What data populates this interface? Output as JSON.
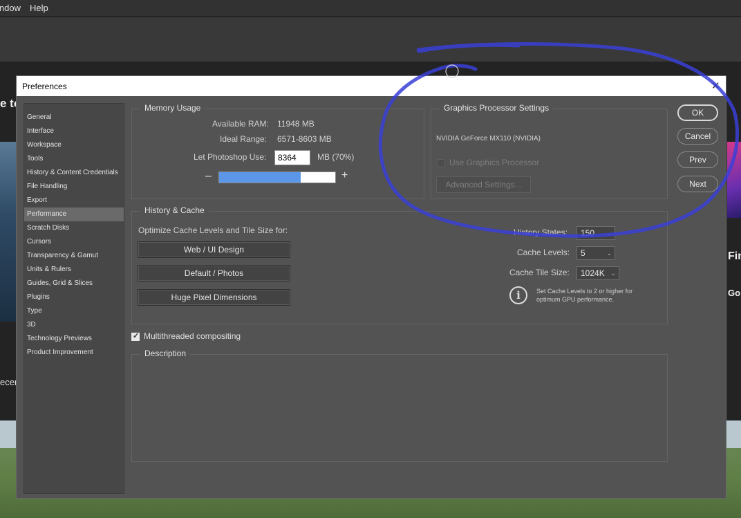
{
  "menubar": {
    "items": [
      "indow",
      "Help"
    ]
  },
  "background": {
    "left_heading": "e to",
    "left_text": "ecent",
    "right_text1": "Fin",
    "right_text2": "Go"
  },
  "dialog": {
    "title": "Preferences",
    "close_glyph": "✕"
  },
  "sidebar": {
    "items": [
      {
        "label": "General"
      },
      {
        "label": "Interface"
      },
      {
        "label": "Workspace"
      },
      {
        "label": "Tools"
      },
      {
        "label": "History & Content Credentials"
      },
      {
        "label": "File Handling"
      },
      {
        "label": "Export"
      },
      {
        "label": "Performance",
        "active": true
      },
      {
        "label": "Scratch Disks"
      },
      {
        "label": "Cursors"
      },
      {
        "label": "Transparency & Gamut"
      },
      {
        "label": "Units & Rulers"
      },
      {
        "label": "Guides, Grid & Slices"
      },
      {
        "label": "Plugins"
      },
      {
        "label": "Type"
      },
      {
        "label": "3D"
      },
      {
        "label": "Technology Previews"
      },
      {
        "label": "Product Improvement"
      }
    ]
  },
  "memory": {
    "legend": "Memory Usage",
    "available_label": "Available RAM:",
    "available_value": "11948 MB",
    "ideal_label": "Ideal Range:",
    "ideal_value": "6571-8603 MB",
    "use_label": "Let Photoshop Use:",
    "use_value": "8364",
    "use_unit": "MB (70%)",
    "slider_fraction": 0.7,
    "minus": "–",
    "plus": "+"
  },
  "gpu": {
    "legend": "Graphics Processor Settings",
    "device": "NVIDIA GeForce MX110 (NVIDIA)",
    "use_gpu_label": "Use Graphics Processor",
    "use_gpu_checked": false,
    "advanced_label": "Advanced Settings..."
  },
  "buttons": {
    "ok": "OK",
    "cancel": "Cancel",
    "prev": "Prev",
    "next": "Next"
  },
  "history_cache": {
    "legend": "History & Cache",
    "optimize_label": "Optimize Cache Levels and Tile Size for:",
    "preset_web": "Web / UI Design",
    "preset_default": "Default / Photos",
    "preset_huge": "Huge Pixel Dimensions",
    "history_states_label": "History States:",
    "history_states_value": "150",
    "cache_levels_label": "Cache Levels:",
    "cache_levels_value": "5",
    "tile_size_label": "Cache Tile Size:",
    "tile_size_value": "1024K",
    "info_line1": "Set Cache Levels to 2 or higher for",
    "info_line2": "optimum GPU performance."
  },
  "multithreaded": {
    "label": "Multithreaded compositing",
    "checked": true
  },
  "description": {
    "legend": "Description"
  },
  "colors": {
    "annotation": "#3a3fd6",
    "slider_fill": "#5b96e8",
    "dialog_bg": "#535353"
  }
}
